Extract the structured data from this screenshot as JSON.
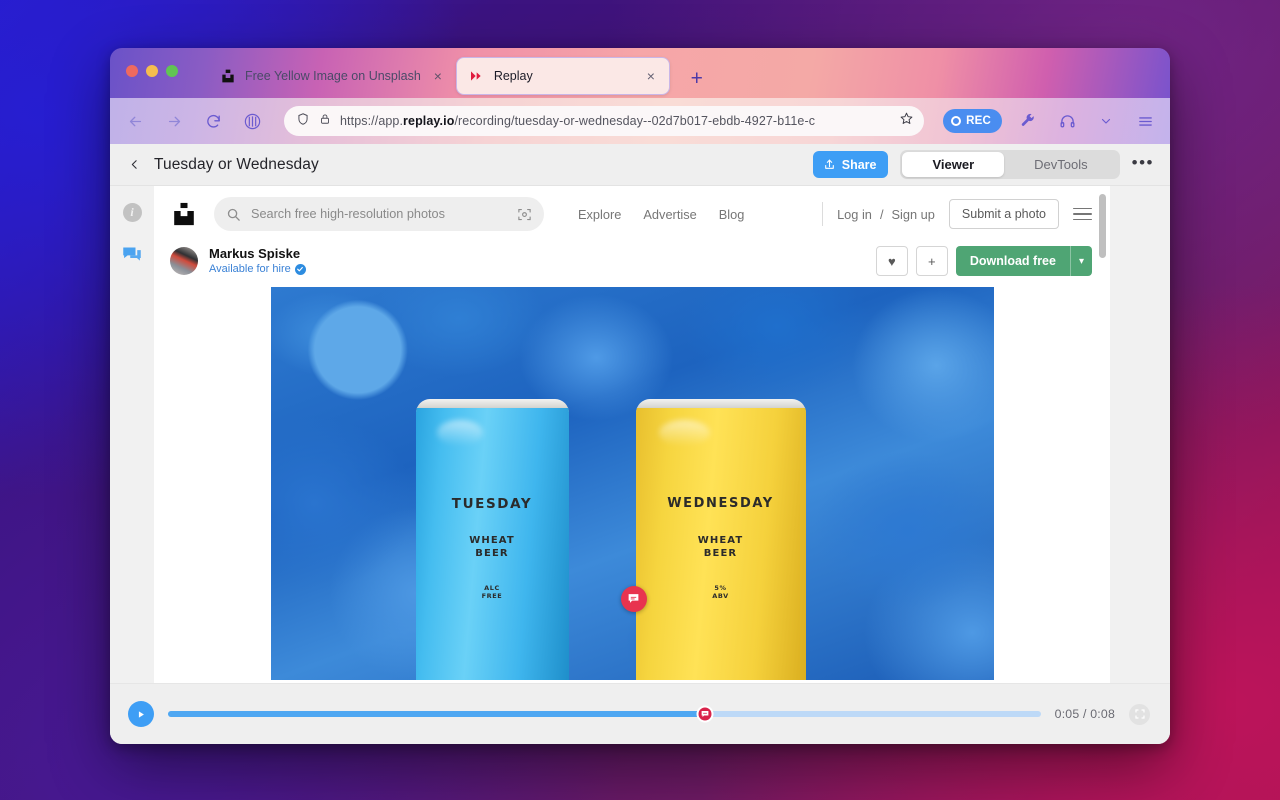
{
  "browser": {
    "tabs": [
      {
        "title": "Free Yellow Image on Unsplash",
        "favicon": "unsplash-icon",
        "active": false,
        "close_label": "×"
      },
      {
        "title": "Replay",
        "favicon": "replay-icon",
        "active": true,
        "close_label": "×"
      }
    ],
    "new_tab_label": "+",
    "url_prefix": "https://app.",
    "url_domain": "replay.io",
    "url_suffix": "/recording/tuesday-or-wednesday--02d7b017-ebdb-4927-b11e-c",
    "record_button_label": "REC",
    "icons": {
      "back": "back-arrow-icon",
      "forward": "forward-arrow-icon",
      "reload": "reload-icon",
      "library": "library-icon",
      "shield": "shield-icon",
      "lock": "lock-icon",
      "bookmark": "star-icon",
      "tools": "wrench-icon",
      "account": "headset-icon",
      "menu": "hamburger-menu-icon"
    }
  },
  "replay": {
    "back_label": "‹",
    "recording_title": "Tuesday or Wednesday",
    "share_label": "Share",
    "tabs": [
      {
        "label": "Viewer",
        "active": true
      },
      {
        "label": "DevTools",
        "active": false
      }
    ],
    "more_label": "•••",
    "sidebar": [
      {
        "name": "info-icon",
        "glyph": "i",
        "selected": false
      },
      {
        "name": "comments-icon",
        "glyph": "",
        "selected": true
      }
    ],
    "timeline": {
      "play_label": "▶",
      "current_time": "0:05",
      "separator": "/",
      "total_time": "0:08",
      "progress_percent": 61.5,
      "comment_marker_percent": 61.5,
      "fullscreen_label": "fullscreen-icon"
    },
    "colors": {
      "accent_blue": "#3e9ef5",
      "marker_red": "#d9224a",
      "track_played": "#4ea7f2",
      "track_remaining": "#bdd9f7"
    }
  },
  "unsplash": {
    "logo": "unsplash-logo",
    "search": {
      "placeholder": "Search free high-resolution photos",
      "value": "",
      "search_icon": "search-icon",
      "visual_search_icon": "visual-search-icon"
    },
    "nav_links": [
      "Explore",
      "Advertise",
      "Blog"
    ],
    "auth": {
      "login": "Log in",
      "separator": "/",
      "signup": "Sign up"
    },
    "submit_label": "Submit a photo",
    "menu_label": "hamburger-menu-icon",
    "author": {
      "name": "Markus Spiske",
      "status": "Available for hire",
      "verified_icon": "verified-badge-icon"
    },
    "actions": {
      "like_label": "♥",
      "add_label": "+",
      "download_label": "Download free",
      "download_caret": "▾",
      "download_color": "#4fa574"
    },
    "photo": {
      "alt": "Two beer cans on blue hydrangea petals",
      "cans": [
        {
          "title": "TUESDAY",
          "sub_line1": "WHEAT",
          "sub_line2": "BEER",
          "abv_line1": "ALC",
          "abv_line2": "FREE",
          "color": "#45bdf0"
        },
        {
          "title": "WEDNESDAY",
          "sub_line1": "WHEAT",
          "sub_line2": "BEER",
          "abv_line1": "5%",
          "abv_line2": "ABV",
          "color": "#f6d53f"
        }
      ],
      "comment_pin": "comment-pin-icon"
    }
  }
}
